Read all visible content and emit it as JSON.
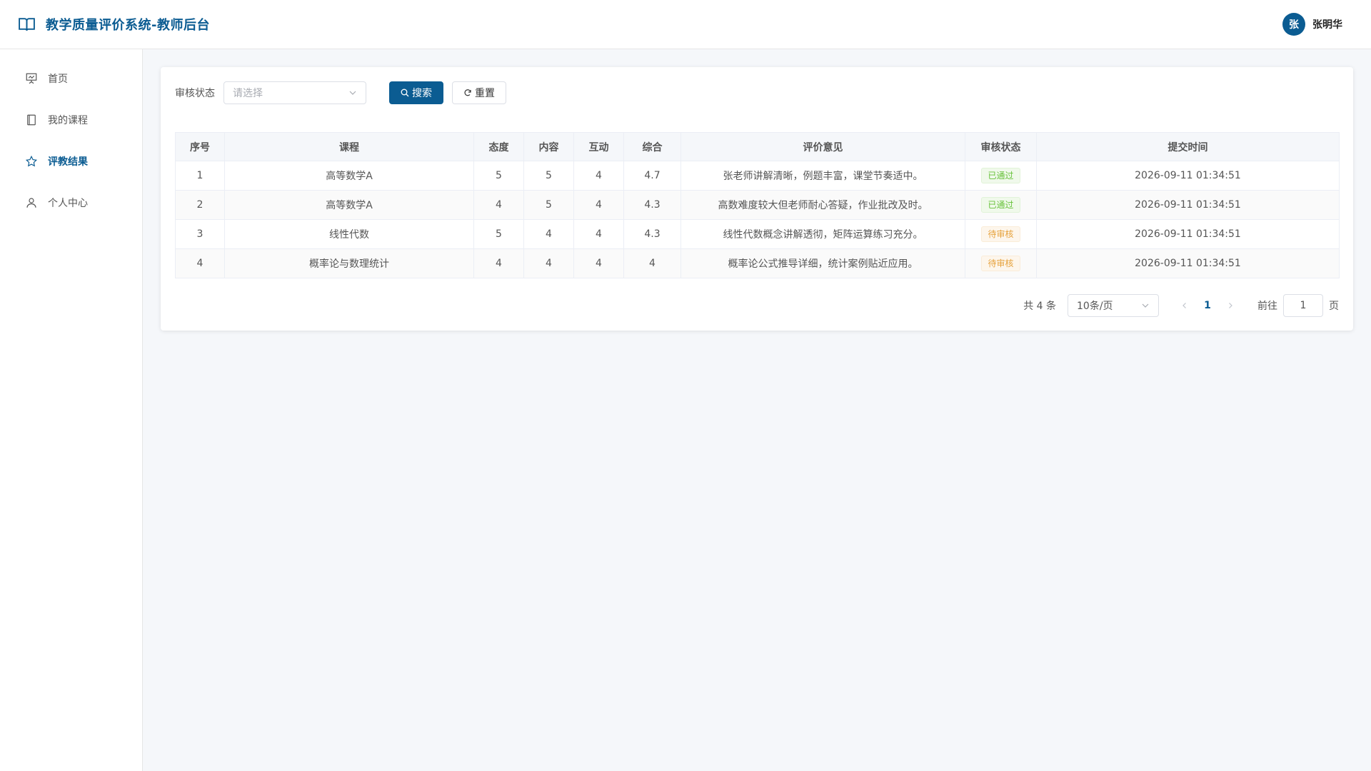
{
  "header": {
    "title": "教学质量评价系统-教师后台",
    "user_avatar": "张",
    "user_name": "张明华",
    "accent_color": "#0b5c92"
  },
  "sidebar": {
    "items": [
      {
        "label": "首页",
        "icon": "presentation-icon",
        "active": false
      },
      {
        "label": "我的课程",
        "icon": "notebook-icon",
        "active": false
      },
      {
        "label": "评教结果",
        "icon": "star-icon",
        "active": true
      },
      {
        "label": "个人中心",
        "icon": "user-icon",
        "active": false
      }
    ]
  },
  "filter": {
    "label": "审核状态",
    "placeholder": "请选择",
    "search_label": "搜索",
    "reset_label": "重置"
  },
  "table": {
    "columns": [
      "序号",
      "课程",
      "态度",
      "内容",
      "互动",
      "综合",
      "评价意见",
      "审核状态",
      "提交时间"
    ],
    "rows": [
      {
        "index": "1",
        "course": "高等数学A",
        "attitude": "5",
        "content": "5",
        "interaction": "4",
        "overall": "4.7",
        "comment": "张老师讲解清晰，例题丰富，课堂节奏适中。",
        "status": "已通过",
        "status_type": "success",
        "time": "2026-09-11 01:34:51"
      },
      {
        "index": "2",
        "course": "高等数学A",
        "attitude": "4",
        "content": "5",
        "interaction": "4",
        "overall": "4.3",
        "comment": "高数难度较大但老师耐心答疑，作业批改及时。",
        "status": "已通过",
        "status_type": "success",
        "time": "2026-09-11 01:34:51"
      },
      {
        "index": "3",
        "course": "线性代数",
        "attitude": "5",
        "content": "4",
        "interaction": "4",
        "overall": "4.3",
        "comment": "线性代数概念讲解透彻，矩阵运算练习充分。",
        "status": "待审核",
        "status_type": "warning",
        "time": "2026-09-11 01:34:51"
      },
      {
        "index": "4",
        "course": "概率论与数理统计",
        "attitude": "4",
        "content": "4",
        "interaction": "4",
        "overall": "4",
        "comment": "概率论公式推导详细，统计案例贴近应用。",
        "status": "待审核",
        "status_type": "warning",
        "time": "2026-09-11 01:34:51"
      }
    ]
  },
  "pagination": {
    "total_text": "共 4 条",
    "page_size": "10条/页",
    "current_page": "1",
    "goto_label": "前往",
    "goto_value": "1",
    "page_unit": "页"
  }
}
